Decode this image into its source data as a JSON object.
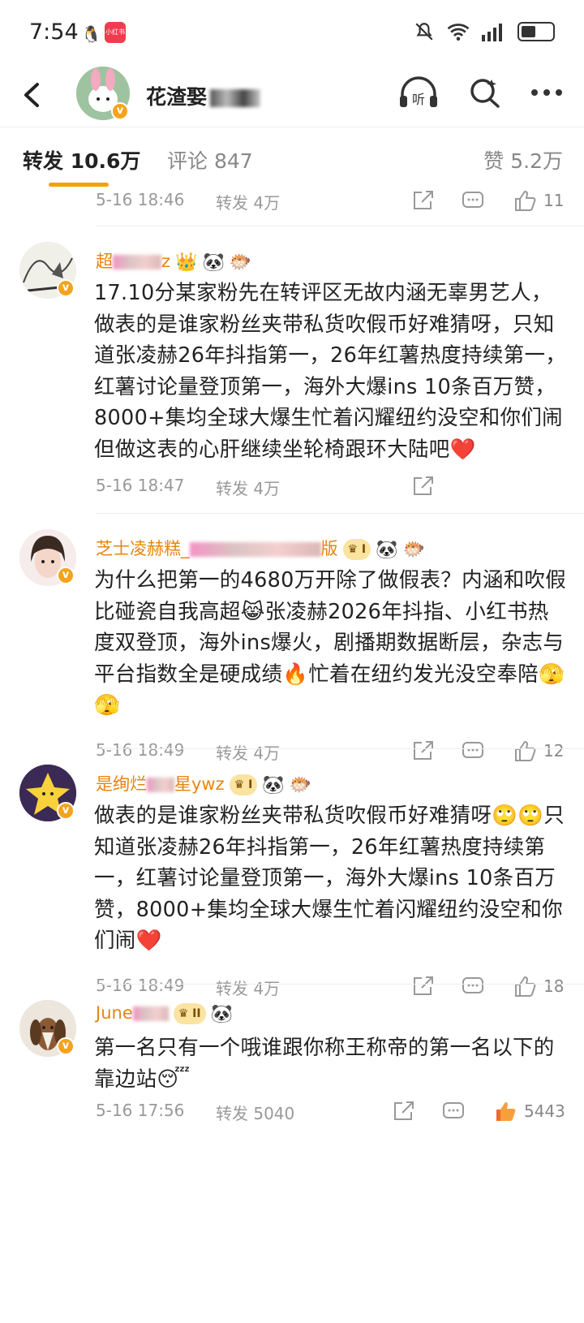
{
  "status_bar": {
    "time": "7:54",
    "app_badge": "小红书"
  },
  "header": {
    "title": "花渣娶",
    "listen_icon": "headphones-icon",
    "search_icon": "search-icon",
    "more_icon": "more-icon"
  },
  "tabs": {
    "repost": "转发 10.6万",
    "comment": "评论 847",
    "like": "赞 5.2万"
  },
  "prev_item": {
    "time": "5-16 18:46",
    "repost": "转发 4万",
    "likes": "11"
  },
  "comments": [
    {
      "user": "超",
      "user_suffix": "z",
      "text": "17.10分某家粉先在转评区无故内涵无辜男艺人，做表的是谁家粉丝夹带私货吹假币好难猜呀，只知道张凌赫26年抖指第一，26年红薯热度持续第一，红薯讨论量登顶第一，海外大爆ins 10条百万赞，8000+集均全球大爆生忙着闪耀纽约没空和你们闹但做这表的心肝继续坐轮椅跟环大陆吧❤️",
      "time": "5-16 18:47",
      "repost": "转发 4万"
    },
    {
      "user": "芝士凌赫糕_",
      "user_suffix": "版",
      "text": "为什么把第一的4680万开除了做假表？内涵和吹假比碰瓷自我高超😹张凌赫2026年抖指、小红书热度双登顶，海外ins爆火，剧播期数据断层，杂志与平台指数全是硬成绩🔥忙着在纽约发光没空奉陪🫣🫣",
      "time": "5-16 18:49",
      "repost": "转发 4万",
      "likes": "12"
    },
    {
      "user": "是绚烂",
      "user_suffix": "星ywz",
      "text": "做表的是谁家粉丝夹带私货吹假币好难猜呀🙄🙄只知道张凌赫26年抖指第一，26年红薯热度持续第一，红薯讨论量登顶第一，海外大爆ins 10条百万赞，8000+集均全球大爆生忙着闪耀纽约没空和你们闹❤️",
      "time": "5-16 18:49",
      "repost": "转发 4万",
      "likes": "18"
    },
    {
      "user": "June",
      "user_suffix": "",
      "text": "第一名只有一个哦谁跟你称王称帝的第一名以下的靠边站😴",
      "time": "5-16 17:56",
      "repost": "转发 5040",
      "likes": "5443"
    }
  ],
  "colors": {
    "accent": "#f4a100",
    "username": "#e6850e",
    "liked": "#f06a2a"
  }
}
